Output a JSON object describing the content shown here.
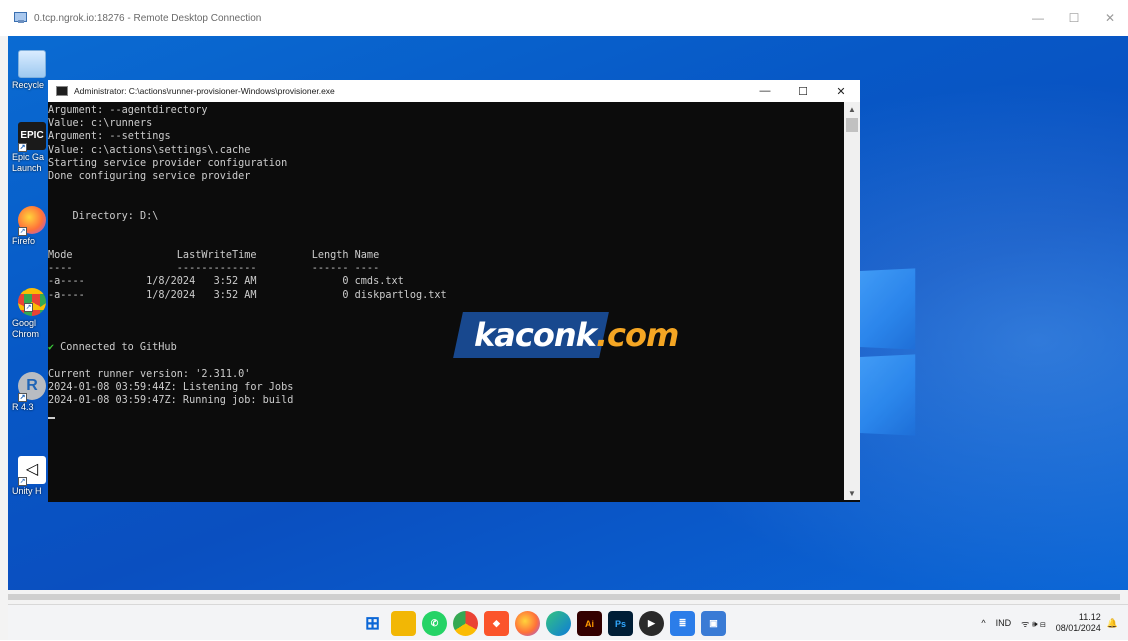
{
  "rdp": {
    "title": "0.tcp.ngrok.io:18276 - Remote Desktop Connection",
    "controls": {
      "minimize": "—",
      "maximize": "☐",
      "close": "✕"
    }
  },
  "desktop": {
    "icons": [
      {
        "label": "Recycle",
        "icon": "recycle-bin-icon"
      },
      {
        "label": "Epic Ga",
        "label2": "Launch",
        "icon": "epic-games-icon"
      },
      {
        "label": "Firefo",
        "icon": "firefox-icon"
      },
      {
        "label": "Googl",
        "label2": "Chrom",
        "icon": "chrome-icon"
      },
      {
        "label": "R 4.3",
        "icon": "r-icon"
      },
      {
        "label": "Unity H",
        "icon": "unity-icon"
      }
    ]
  },
  "console": {
    "title": "Administrator: C:\\actions\\runner-provisioner-Windows\\provisioner.exe",
    "controls": {
      "minimize": "—",
      "maximize": "☐",
      "close": "✕"
    },
    "lines": [
      "Argument: --agentdirectory",
      "Value: c:\\runners",
      "Argument: --settings",
      "Value: c:\\actions\\settings\\.cache",
      "Starting service provider configuration",
      "Done configuring service provider",
      "",
      "",
      "    Directory: D:\\",
      "",
      "",
      "Mode                 LastWriteTime         Length Name",
      "----                 -------------         ------ ----",
      "-a----          1/8/2024   3:52 AM              0 cmds.txt",
      "-a----          1/8/2024   3:52 AM              0 diskpartlog.txt",
      "",
      "",
      "",
      " Connected to GitHub",
      "",
      "Current runner version: '2.311.0'",
      "2024-01-08 03:59:44Z: Listening for Jobs",
      "2024-01-08 03:59:47Z: Running job: build"
    ]
  },
  "watermark": {
    "part1": "kaconk",
    "part2": ".com"
  },
  "taskbar": {
    "apps": [
      {
        "name": "start-button",
        "color": "#0a66d6",
        "glyph": "⊞"
      },
      {
        "name": "file-explorer-icon",
        "color": "#f2b705",
        "glyph": "▆"
      },
      {
        "name": "whatsapp-icon",
        "color": "#25d366",
        "glyph": "✆"
      },
      {
        "name": "chrome-icon",
        "color": "#e8453c",
        "glyph": "◉"
      },
      {
        "name": "brave-icon",
        "color": "#fb542b",
        "glyph": "◆"
      },
      {
        "name": "firefox-icon",
        "color": "#ff7139",
        "glyph": "●"
      },
      {
        "name": "edge-icon",
        "color": "#0f7bd8",
        "glyph": "◐"
      },
      {
        "name": "illustrator-icon",
        "color": "#330000",
        "glyph": "Ai"
      },
      {
        "name": "photoshop-icon",
        "color": "#001e36",
        "glyph": "Ps"
      },
      {
        "name": "media-player-icon",
        "color": "#2a2a2a",
        "glyph": "▶"
      },
      {
        "name": "notepad-icon",
        "color": "#2b7de9",
        "glyph": "≣"
      },
      {
        "name": "remote-desktop-icon",
        "color": "#3a7bd5",
        "glyph": "▣"
      }
    ],
    "tray": {
      "chevron": "^",
      "language": "IND",
      "network_volume_battery": "ᯤ 🕪 ⊟",
      "time": "11.12",
      "date": "08/01/2024",
      "notification": "🔔"
    }
  }
}
